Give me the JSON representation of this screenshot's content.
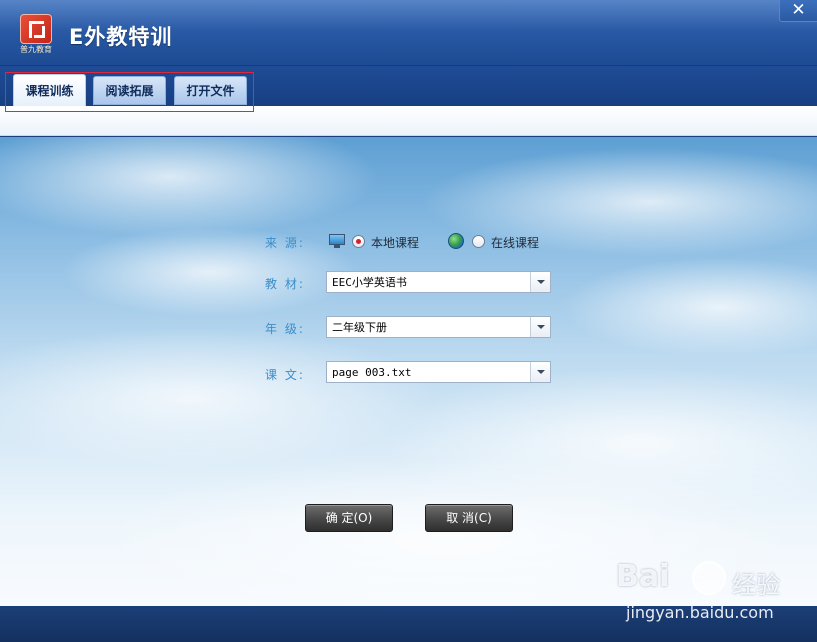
{
  "window": {
    "title": "E外教特训",
    "logo_text": "普九教育",
    "close_glyph": "✕"
  },
  "tabs": [
    {
      "label": "课程训练",
      "active": true
    },
    {
      "label": "阅读拓展",
      "active": false
    },
    {
      "label": "打开文件",
      "active": false
    }
  ],
  "form": {
    "source_label": "来  源:",
    "source_options": [
      {
        "label": "本地课程",
        "checked": true,
        "icon": "monitor-icon"
      },
      {
        "label": "在线课程",
        "checked": false,
        "icon": "globe-icon"
      }
    ],
    "textbook_label": "教  材:",
    "textbook_value": "EEC小学英语书",
    "grade_label": "年  级:",
    "grade_value": "二年级下册",
    "lesson_label": "课  文:",
    "lesson_value": "page 003.txt"
  },
  "buttons": {
    "ok_label": "确 定(O)",
    "cancel_label": "取 消(C)"
  },
  "watermark": {
    "brand": "Bai",
    "brand_cn": "经验",
    "url": "jingyan.baidu.com"
  },
  "colors": {
    "accent_red": "#d3232f",
    "label_blue": "#3a8ec9",
    "titlebar_blue": "#2a5aa6"
  }
}
